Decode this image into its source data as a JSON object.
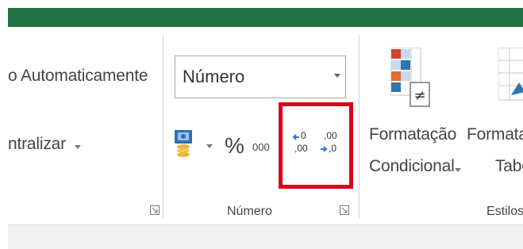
{
  "alignment": {
    "wrap_text_label": "o Automaticamente",
    "merge_center_label": "ntralizar"
  },
  "number_group": {
    "format_value": "Número",
    "percent_symbol": "%",
    "thousands_label": "000",
    "increase_decimal": {
      "top": "0",
      "bottom": ",00"
    },
    "decrease_decimal": {
      "top": ",00",
      "bottom": ",0"
    },
    "group_label": "Número"
  },
  "styles_group": {
    "conditional_formatting": {
      "line1": "Formatação",
      "line2": "Condicional"
    },
    "format_as_table": {
      "line1": "Formata",
      "line2": "Tabe"
    },
    "group_label": "Estilos"
  },
  "colors": {
    "title_bar": "#217346",
    "highlight": "#d9001b"
  }
}
